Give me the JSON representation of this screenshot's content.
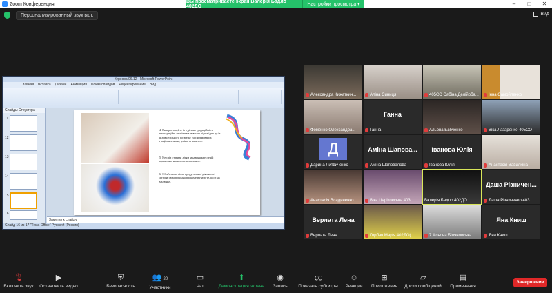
{
  "window": {
    "title": "Zoom Конференция",
    "controls": [
      "–",
      "□",
      "✕"
    ]
  },
  "share_banner": {
    "text": "Вы просматриваете экран Валерія Бадло 402ДО",
    "view_options": "Настройки просмотра ▾"
  },
  "topbar": {
    "audio_pill": "Персонализированный звук вкл.",
    "view_label": "Вид"
  },
  "ppt": {
    "title": "Курсова 06.12 - Microsoft PowerPoint",
    "tabs": [
      "Главная",
      "Вставка",
      "Дизайн",
      "Анимация",
      "Показ слайдов",
      "Рецензирование",
      "Вид"
    ],
    "panel_tabs": [
      "Слайды",
      "Структура"
    ],
    "slide_numbers": [
      "11",
      "12",
      "13",
      "14",
      "15",
      "16",
      "17"
    ],
    "slide_text": [
      "4. Використовуйте із з дітьми традиційні та нетрадиційні техніки малювання відповідно до їх індивідуального розвитку та сформованих графічних знань, умінь та навичок.",
      "5. Не слід ставити дітям завдання кресленій правильно намалювати малюнок.",
      "6. Обов'язково після продуктивної діяльності дитина сама повинна прокоментувати те, що є на малюнку."
    ],
    "notes": "Заметки к слайду",
    "status_text": "Слайд 16 из 17   \"Тема Office\"   Русский (Россия)"
  },
  "participants": [
    {
      "name": "Александра Кижаткин...",
      "big": "",
      "muted": true
    },
    {
      "name": "Аліна Синиця",
      "big": "",
      "muted": true
    },
    {
      "name": "405СО Сабіна Делійоба...",
      "big": "",
      "muted": true
    },
    {
      "name": "Інна Самойленко",
      "big": "",
      "muted": true
    },
    {
      "name": "Фоменко Олександра...",
      "big": "",
      "muted": true
    },
    {
      "name": "Ганна",
      "big": "Ганна",
      "muted": true
    },
    {
      "name": "Альона Бабченко",
      "big": "",
      "muted": true
    },
    {
      "name": "Віка Лазаренко 405СО",
      "big": "",
      "muted": true
    },
    {
      "name": "Дарина Литвиченко",
      "big": "",
      "avatar": "Д",
      "muted": true
    },
    {
      "name": "Аміна Шаповалова",
      "big": "Аміна Шапова...",
      "muted": true
    },
    {
      "name": "Іванова Юлія",
      "big": "Іванова Юлія",
      "muted": true
    },
    {
      "name": "Анастасія Вавилкіна",
      "big": "",
      "muted": true
    },
    {
      "name": "Анастасія Владиченко...",
      "big": "",
      "muted": true
    },
    {
      "name": "Віка Царіковська 403...",
      "big": "",
      "muted": true
    },
    {
      "name": "Валерія Бадло 402ДО",
      "big": "",
      "muted": false,
      "active": true
    },
    {
      "name": "Даша Різниченко 403...",
      "big": "Даша Різничен...",
      "muted": true
    },
    {
      "name": "Верлата Лена",
      "big": "Верлата Лена",
      "muted": true
    },
    {
      "name": "Горбач Марія 402ДО(...",
      "big": "",
      "muted": true
    },
    {
      "name": "7 Альона Біляновська",
      "big": "",
      "muted": true
    },
    {
      "name": "Яна Книш",
      "big": "Яна Книш",
      "muted": true
    }
  ],
  "toolbar": {
    "mute": "Включить звук",
    "video": "Остановить видео",
    "security": "Безопасность",
    "participants": "Участники",
    "participants_count": "20",
    "chat": "Чат",
    "share": "Демонстрация экрана",
    "record": "Запись",
    "captions": "Показать субтитры",
    "reactions": "Реакции",
    "apps": "Приложения",
    "whiteboard": "Доски сообщений",
    "notes": "Примечания",
    "end": "Завершение"
  },
  "colors": {
    "accent_green": "#25c26a",
    "end_red": "#e02828",
    "active_tile": "#d9e65a"
  }
}
